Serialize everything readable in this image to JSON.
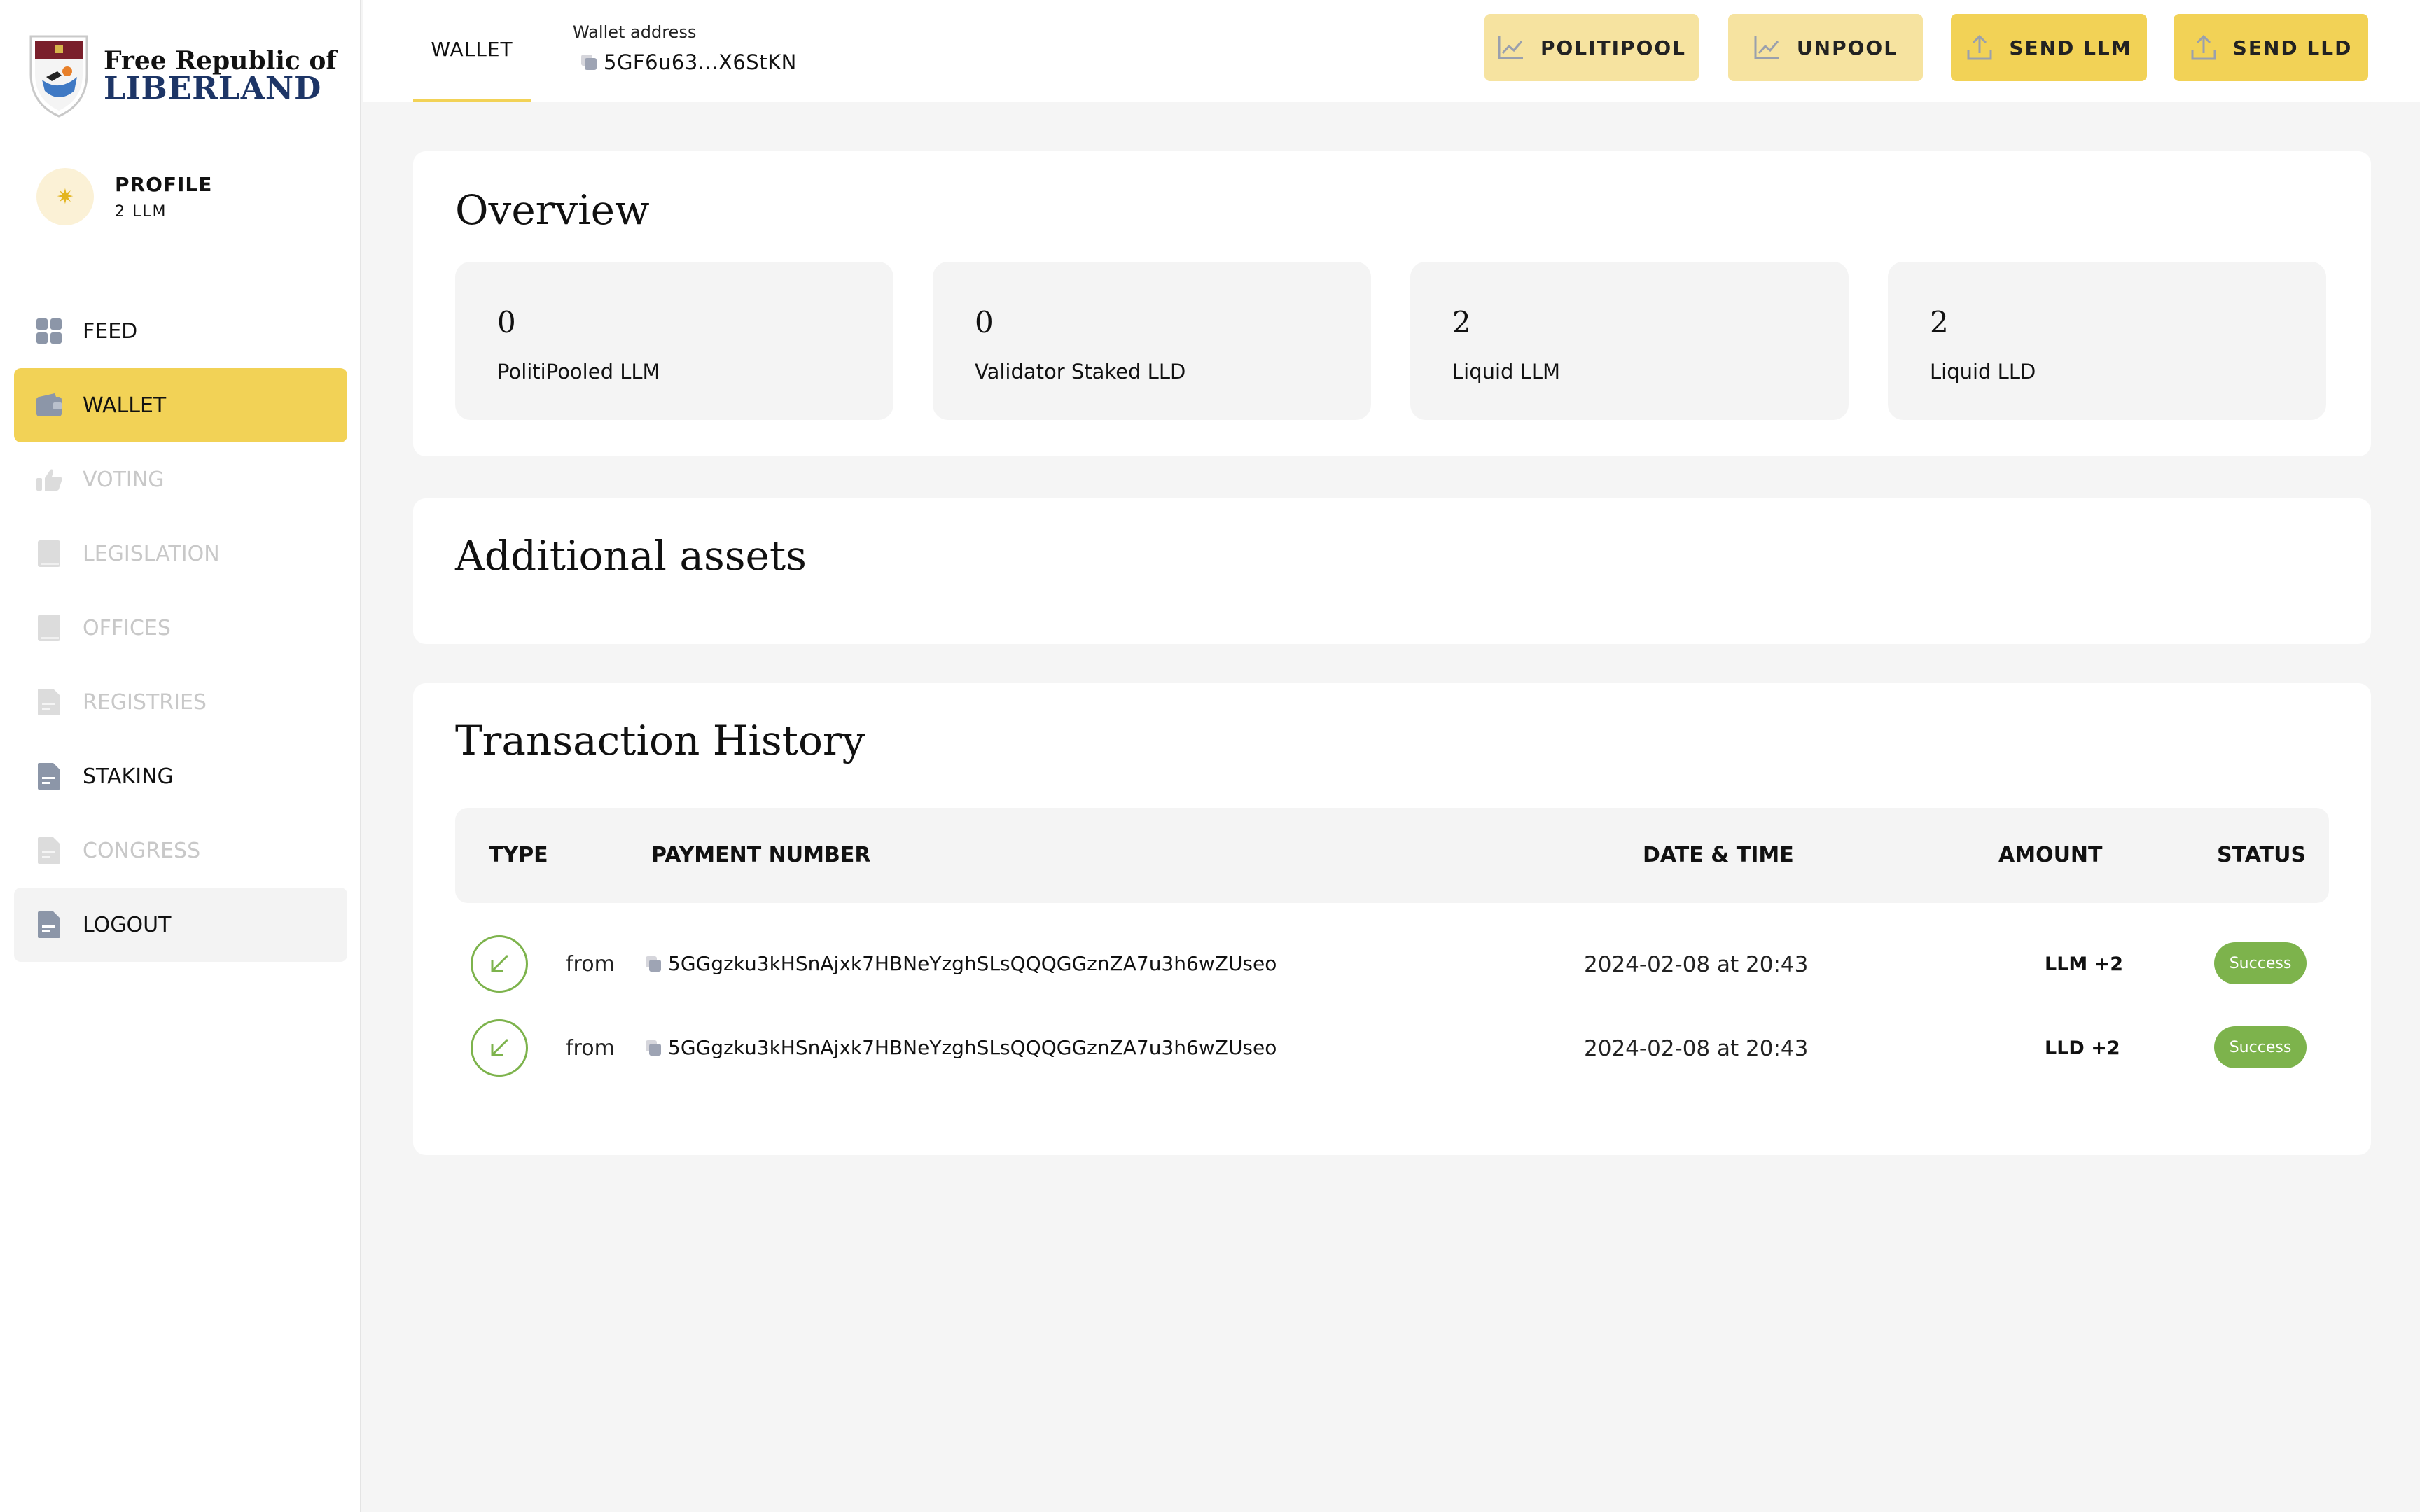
{
  "brand": {
    "line1": "Free Republic of",
    "line2": "LIBERLAND",
    "colors": {
      "navy": "#1d3566",
      "accent": "#f2d256"
    }
  },
  "profile": {
    "name": "PROFILE",
    "balance": "2 LLM",
    "icon": "sun-icon"
  },
  "nav": {
    "items": [
      {
        "label": "FEED",
        "icon": "grid-icon",
        "state": "enabled"
      },
      {
        "label": "WALLET",
        "icon": "wallet-icon",
        "state": "active"
      },
      {
        "label": "VOTING",
        "icon": "thumbs-up-icon",
        "state": "disabled"
      },
      {
        "label": "LEGISLATION",
        "icon": "book-icon",
        "state": "disabled"
      },
      {
        "label": "OFFICES",
        "icon": "book-icon",
        "state": "disabled"
      },
      {
        "label": "REGISTRIES",
        "icon": "document-icon",
        "state": "disabled"
      },
      {
        "label": "STAKING",
        "icon": "document-icon",
        "state": "enabled"
      },
      {
        "label": "CONGRESS",
        "icon": "document-icon",
        "state": "disabled"
      },
      {
        "label": "LOGOUT",
        "icon": "document-icon",
        "state": "logout"
      }
    ]
  },
  "topbar": {
    "tab_label": "WALLET",
    "address_label": "Wallet address",
    "address_value": "5GF6u63...X6StKN",
    "buttons": {
      "politipool": "POLITIPOOL",
      "unpool": "UNPOOL",
      "send_llm": "SEND LLM",
      "send_lld": "SEND LLD"
    }
  },
  "overview": {
    "title": "Overview",
    "cards": [
      {
        "value": "0",
        "label": "PolitiPooled LLM"
      },
      {
        "value": "0",
        "label": "Validator Staked LLD"
      },
      {
        "value": "2",
        "label": "Liquid LLM"
      },
      {
        "value": "2",
        "label": "Liquid LLD"
      }
    ]
  },
  "additional_assets": {
    "title": "Additional assets"
  },
  "transactions": {
    "title": "Transaction History",
    "headers": {
      "type": "TYPE",
      "payment": "PAYMENT NUMBER",
      "date": "DATE & TIME",
      "amount": "AMOUNT",
      "status": "STATUS"
    },
    "rows": [
      {
        "direction": "from",
        "payment_number": "5GGgzku3kHSnAjxk7HBNeYzghSLsQQQGGznZA7u3h6wZUseo",
        "date": "2024-02-08 at 20:43",
        "amount": "LLM +2",
        "status": "Success"
      },
      {
        "direction": "from",
        "payment_number": "5GGgzku3kHSnAjxk7HBNeYzghSLsQQQGGznZA7u3h6wZUseo",
        "date": "2024-02-08 at 20:43",
        "amount": "LLD +2",
        "status": "Success"
      }
    ]
  }
}
